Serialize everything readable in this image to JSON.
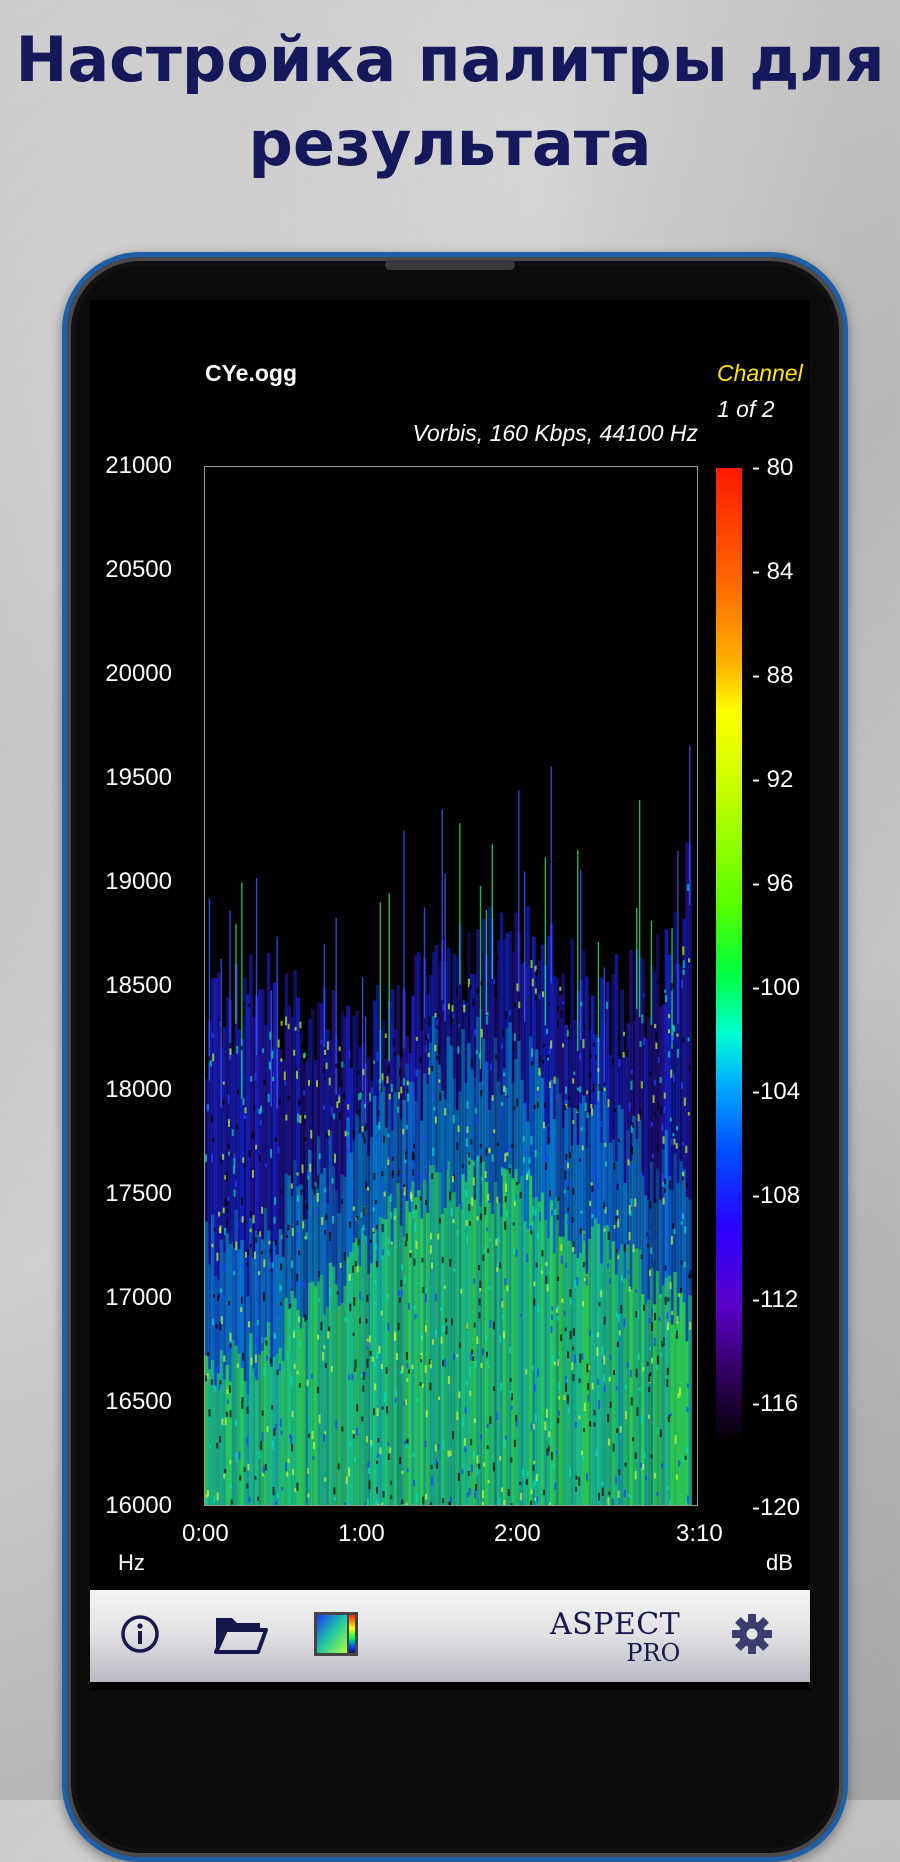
{
  "headline": {
    "line1": "Настройка палитры для",
    "line2": "результата"
  },
  "file": {
    "name": "CYe.ogg",
    "codec_info": "Vorbis, 160 Kbps, 44100 Hz",
    "channel_label": "Channel",
    "channel_value": "1 of 2"
  },
  "chart_data": {
    "type": "heatmap",
    "title": "CYe.ogg",
    "subtitle": "Vorbis, 160 Kbps, 44100 Hz",
    "xlabel": "",
    "ylabel": "Hz",
    "colorbar_label": "dB",
    "x_ticks": [
      "0:00",
      "1:00",
      "2:00",
      "3:10"
    ],
    "y_ticks": [
      21000,
      20500,
      20000,
      19500,
      19000,
      18500,
      18000,
      17500,
      17000,
      16500,
      16000
    ],
    "ylim": [
      16000,
      21000
    ],
    "xlim_seconds": [
      0,
      190
    ],
    "color_scale_db": [
      -80,
      -84,
      -88,
      -92,
      -96,
      -100,
      -104,
      -108,
      -112,
      -116,
      -120
    ],
    "color_scale_labels": [
      "- 80",
      "- 84",
      "- 88",
      "- 92",
      "- 96",
      "-100",
      "-104",
      "-108",
      "-112",
      "-116",
      "-120"
    ],
    "palette": [
      "#ff1a00",
      "#ff6a00",
      "#ffff00",
      "#55ff00",
      "#00ffd0",
      "#0050ff",
      "#5a00c8",
      "#000000"
    ],
    "energy_envelope": {
      "time_seconds": [
        0,
        20,
        40,
        60,
        80,
        100,
        120,
        140,
        160,
        180,
        190
      ],
      "upper_freq_hz": [
        18300,
        18500,
        18300,
        18200,
        18400,
        18600,
        18700,
        18500,
        18400,
        18600,
        19400
      ],
      "dense_green_upper_hz": [
        16600,
        16700,
        17000,
        17200,
        17500,
        17600,
        17500,
        17300,
        17200,
        17000,
        16800
      ]
    }
  },
  "units": {
    "y": "Hz",
    "colorbar": "dB"
  },
  "toolbar": {
    "brand_name": "ASPECT",
    "brand_sub": "PRO",
    "icons": [
      "info-icon",
      "folder-open-icon",
      "palette-icon",
      "gear-icon"
    ]
  },
  "colors": {
    "headline": "#15185a",
    "channel_label": "#ffe600",
    "phone_border": "#1f5fa8",
    "brand": "#16184d"
  }
}
